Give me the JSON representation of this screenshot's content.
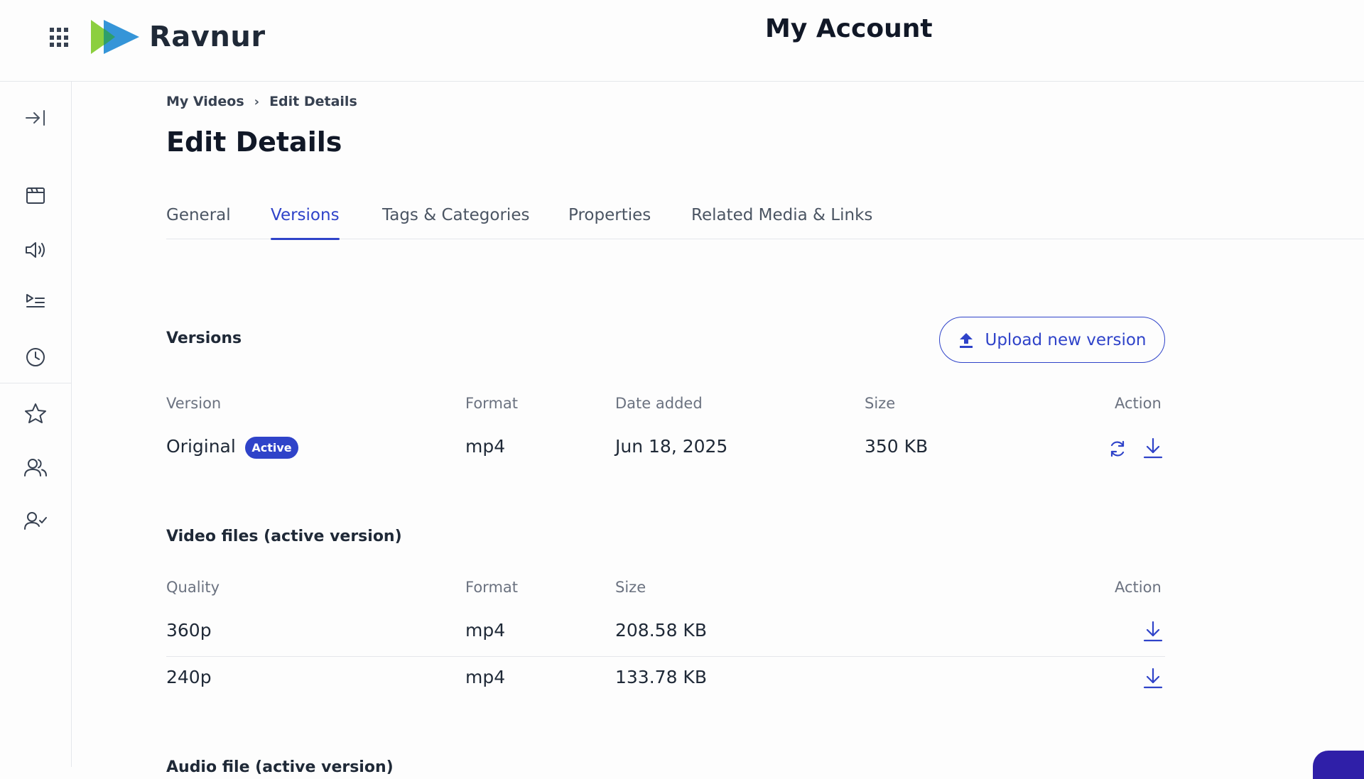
{
  "header": {
    "brand": "Ravnur",
    "title": "My Account",
    "apps_icon": "apps-grid-icon",
    "logo_colors": {
      "green": "#8ccf3f",
      "blue": "#2a8fd6"
    }
  },
  "sidebar": {
    "items": [
      {
        "name": "collapse-sidebar",
        "icon": "arrow-right-bar-icon"
      },
      {
        "name": "videos",
        "icon": "calendar-video-icon"
      },
      {
        "name": "audio",
        "icon": "speaker-icon"
      },
      {
        "name": "playlists",
        "icon": "playlist-icon"
      },
      {
        "name": "history",
        "icon": "clock-icon"
      },
      {
        "name": "favorites",
        "icon": "star-icon"
      },
      {
        "name": "groups",
        "icon": "users-icon"
      },
      {
        "name": "subscriptions",
        "icon": "user-check-icon"
      }
    ]
  },
  "breadcrumb": {
    "parent": "My Videos",
    "separator": "›",
    "current": "Edit Details"
  },
  "page": {
    "title": "Edit Details"
  },
  "tabs": [
    {
      "label": "General",
      "active": false
    },
    {
      "label": "Versions",
      "active": true
    },
    {
      "label": "Tags & Categories",
      "active": false
    },
    {
      "label": "Properties",
      "active": false
    },
    {
      "label": "Related Media & Links",
      "active": false
    }
  ],
  "versions": {
    "title": "Versions",
    "upload_label": "Upload new version",
    "columns": [
      "Version",
      "Format",
      "Date added",
      "Size",
      "Action"
    ],
    "rows": [
      {
        "version": "Original",
        "badge": "Active",
        "format": "mp4",
        "date_added": "Jun 18, 2025",
        "size": "350 KB"
      }
    ]
  },
  "video_files": {
    "title": "Video files (active version)",
    "columns": [
      "Quality",
      "Format",
      "Size",
      "Action"
    ],
    "rows": [
      {
        "quality": "360p",
        "format": "mp4",
        "size": "208.58 KB"
      },
      {
        "quality": "240p",
        "format": "mp4",
        "size": "133.78 KB"
      }
    ]
  },
  "audio_file": {
    "title": "Audio file (active version)"
  },
  "colors": {
    "accent": "#2f43c9",
    "text": "#1f2937",
    "muted": "#6b7280",
    "border": "#e5e7eb"
  }
}
